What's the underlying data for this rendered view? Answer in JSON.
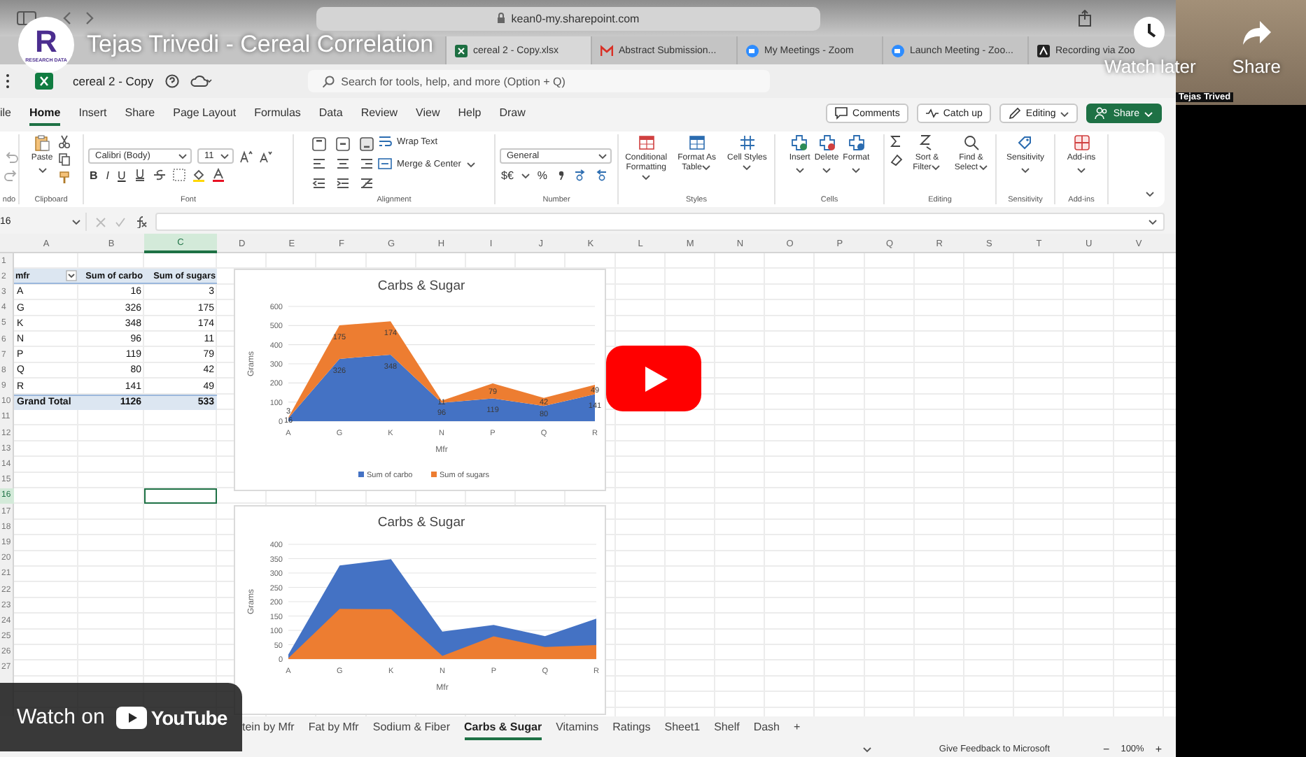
{
  "video": {
    "title": "Tejas Trivedi - Cereal Correlation",
    "logo_letter": "R",
    "logo_caption": "RESEARCH DATA",
    "actions": [
      {
        "label": "Watch later"
      },
      {
        "label": "Share"
      }
    ],
    "watch_on": "Watch on",
    "brand": "YouTube",
    "webcam_name": "Tejas Trived"
  },
  "browser": {
    "url": "kean0-my.sharepoint.com",
    "tabs": [
      {
        "label": "cereal 2 - Copy.xlsx",
        "selected": true
      },
      {
        "label": "Abstract Submission...",
        "selected": false
      },
      {
        "label": "My Meetings - Zoom",
        "selected": false
      },
      {
        "label": "Launch Meeting - Zoo...",
        "selected": false
      },
      {
        "label": "Recording via Zoo",
        "selected": false
      }
    ]
  },
  "excel": {
    "file_name": "cereal 2 - Copy",
    "search": {
      "placeholder": "Search for tools, help, and more (Option + Q)"
    },
    "menu": [
      {
        "label": "ile",
        "selected": false
      },
      {
        "label": "Home",
        "selected": true
      },
      {
        "label": "Insert",
        "selected": false
      },
      {
        "label": "Share",
        "selected": false
      },
      {
        "label": "Page Layout",
        "selected": false
      },
      {
        "label": "Formulas",
        "selected": false
      },
      {
        "label": "Data",
        "selected": false
      },
      {
        "label": "Review",
        "selected": false
      },
      {
        "label": "View",
        "selected": false
      },
      {
        "label": "Help",
        "selected": false
      },
      {
        "label": "Draw",
        "selected": false
      }
    ],
    "actions": [
      "Comments",
      "Catch up",
      "Editing",
      "Share"
    ],
    "ribbon": {
      "undo": {
        "label": "ndo"
      },
      "clipboard": {
        "paste": "Paste",
        "label": "Clipboard"
      },
      "font": {
        "font_name": "Calibri (Body)",
        "font_size": "11",
        "styles": [
          "B",
          "I",
          "U"
        ],
        "label": "Font"
      },
      "alignment": {
        "wrap": "Wrap Text",
        "merge": "Merge & Center",
        "label": "Alignment"
      },
      "number": {
        "format": "General",
        "currency": "$€",
        "percent": "%",
        "label": "Number"
      },
      "styles": {
        "buttons": [
          "Conditional Formatting",
          "Format As Table",
          "Cell Styles"
        ],
        "label": "Styles"
      },
      "cells": {
        "buttons": [
          "Insert",
          "Delete",
          "Format"
        ],
        "label": "Cells"
      },
      "editing": {
        "buttons": [
          "Sort & Filter",
          "Find & Select"
        ],
        "label": "Editing"
      },
      "sensitivity": {
        "buttons": [
          "Sensitivity"
        ],
        "label": "Sensitivity"
      },
      "addins": {
        "buttons": [
          "Add-ins"
        ],
        "label": "Add-ins"
      }
    },
    "name_box": "16",
    "columns": [
      {
        "label": "A",
        "selected": false
      },
      {
        "label": "B",
        "selected": false
      },
      {
        "label": "C",
        "selected": true
      },
      {
        "label": "D",
        "selected": false
      },
      {
        "label": "E",
        "selected": false
      },
      {
        "label": "F",
        "selected": false
      },
      {
        "label": "G",
        "selected": false
      },
      {
        "label": "H",
        "selected": false
      },
      {
        "label": "I",
        "selected": false
      },
      {
        "label": "J",
        "selected": false
      },
      {
        "label": "K",
        "selected": false
      },
      {
        "label": "L",
        "selected": false
      },
      {
        "label": "M",
        "selected": false
      },
      {
        "label": "N",
        "selected": false
      },
      {
        "label": "O",
        "selected": false
      },
      {
        "label": "P",
        "selected": false
      },
      {
        "label": "Q",
        "selected": false
      },
      {
        "label": "R",
        "selected": false
      },
      {
        "label": "S",
        "selected": false
      },
      {
        "label": "T",
        "selected": false
      },
      {
        "label": "U",
        "selected": false
      },
      {
        "label": "V",
        "selected": false
      }
    ],
    "rows": [
      {
        "label": "1",
        "selected": false
      },
      {
        "label": "2",
        "selected": false
      },
      {
        "label": "3",
        "selected": false
      },
      {
        "label": "4",
        "selected": false
      },
      {
        "label": "5",
        "selected": false
      },
      {
        "label": "6",
        "selected": false
      },
      {
        "label": "7",
        "selected": false
      },
      {
        "label": "8",
        "selected": false
      },
      {
        "label": "9",
        "selected": false
      },
      {
        "label": "10",
        "selected": false
      },
      {
        "label": "11",
        "selected": false
      },
      {
        "label": "12",
        "selected": false
      },
      {
        "label": "13",
        "selected": false
      },
      {
        "label": "14",
        "selected": false
      },
      {
        "label": "15",
        "selected": false
      },
      {
        "label": "16",
        "selected": true
      },
      {
        "label": "17",
        "selected": false
      },
      {
        "label": "18",
        "selected": false
      },
      {
        "label": "19",
        "selected": false
      },
      {
        "label": "20",
        "selected": false
      },
      {
        "label": "21",
        "selected": false
      },
      {
        "label": "22",
        "selected": false
      },
      {
        "label": "23",
        "selected": false
      },
      {
        "label": "24",
        "selected": false
      },
      {
        "label": "25",
        "selected": false
      },
      {
        "label": "26",
        "selected": false
      },
      {
        "label": "27",
        "selected": false
      }
    ],
    "pivot": {
      "columns": [
        "mfr",
        "Sum of carbo",
        "Sum of sugars"
      ],
      "rows": [
        [
          "A",
          "16",
          "3"
        ],
        [
          "G",
          "326",
          "175"
        ],
        [
          "K",
          "348",
          "174"
        ],
        [
          "N",
          "96",
          "11"
        ],
        [
          "P",
          "119",
          "79"
        ],
        [
          "Q",
          "80",
          "42"
        ],
        [
          "R",
          "141",
          "49"
        ]
      ],
      "total": [
        "Grand Total",
        "1126",
        "533"
      ]
    },
    "charts": [
      {
        "chart_data": {
          "type": "area",
          "title": "Carbs & Sugar",
          "xlabel": "Mfr",
          "ylabel": "Grams",
          "categories": [
            "A",
            "G",
            "K",
            "N",
            "P",
            "Q",
            "R"
          ],
          "stacked": true,
          "value_labels": [
            [
              "16",
              "326",
              "348",
              "96",
              "119",
              "80",
              "141"
            ],
            [
              "3",
              "175",
              "174",
              "11",
              "79",
              "42",
              "49"
            ]
          ],
          "grid": true,
          "legend": true,
          "ylim": [
            0,
            600
          ],
          "yticks": [
            0,
            100,
            200,
            300,
            400,
            500,
            600
          ],
          "series": [
            {
              "name": "Sum of carbo",
              "color": "#4472c4",
              "values": [
                16,
                326,
                348,
                96,
                119,
                80,
                141
              ]
            },
            {
              "name": "Sum of sugars",
              "color": "#ed7d31",
              "values": [
                3,
                175,
                174,
                11,
                79,
                42,
                49
              ]
            }
          ]
        }
      },
      {
        "chart_data": {
          "type": "area",
          "title": "Carbs & Sugar",
          "xlabel": "Mfr",
          "ylabel": "Grams",
          "categories": [
            "A",
            "G",
            "K",
            "N",
            "P",
            "Q",
            "R"
          ],
          "stacked": false,
          "grid": true,
          "ylim": [
            0,
            400
          ],
          "yticks": [
            0,
            50,
            100,
            150,
            200,
            250,
            300,
            350,
            400
          ],
          "series": [
            {
              "color": "#4472c4",
              "values": [
                16,
                326,
                348,
                96,
                119,
                80,
                141
              ]
            },
            {
              "color": "#ed7d31",
              "values": [
                3,
                175,
                174,
                11,
                79,
                42,
                49
              ]
            }
          ]
        }
      }
    ],
    "sheet_tabs": [
      {
        "label": "tein by Mfr",
        "selected": false
      },
      {
        "label": "Fat by Mfr",
        "selected": false
      },
      {
        "label": "Sodium & Fiber",
        "selected": false
      },
      {
        "label": "Carbs & Sugar",
        "selected": true
      },
      {
        "label": "Vitamins",
        "selected": false
      },
      {
        "label": "Ratings",
        "selected": false
      },
      {
        "label": "Sheet1",
        "selected": false
      },
      {
        "label": "Shelf",
        "selected": false
      },
      {
        "label": "Dash",
        "selected": false
      },
      {
        "label": "+",
        "selected": false
      }
    ],
    "status": {
      "feedback": "Give Feedback to Microsoft",
      "zoom": "100%",
      "zoom_out": "−",
      "zoom_in": "+"
    }
  }
}
